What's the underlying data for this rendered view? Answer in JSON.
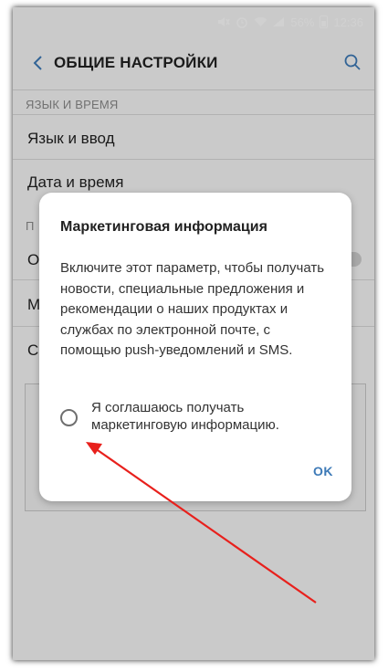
{
  "status_bar": {
    "battery": "56%",
    "time": "12:36"
  },
  "header": {
    "title": "ОБЩИЕ НАСТРОЙКИ"
  },
  "settings": {
    "section_language": "ЯЗЫК И ВРЕМЯ",
    "items": [
      {
        "label": "Язык и ввод"
      },
      {
        "label": "Дата и время"
      }
    ],
    "section_partial": "П",
    "partial_rows": [
      {
        "label": "О"
      },
      {
        "label": "М"
      },
      {
        "label": "С"
      }
    ]
  },
  "dialog": {
    "title": "Маркетинговая информация",
    "body": "Включите этот параметр, чтобы получать новости, специальные предложения и рекомендации о наших продуктах и службах по электронной почте, с помощью push-уведомлений и SMS.",
    "checkbox_label": "Я соглашаюсь получать маркетинговую информацию.",
    "checkbox_checked": false,
    "ok_label": "OK"
  },
  "colors": {
    "accent": "#3d7ab7",
    "annotation_arrow": "#e8201c"
  }
}
